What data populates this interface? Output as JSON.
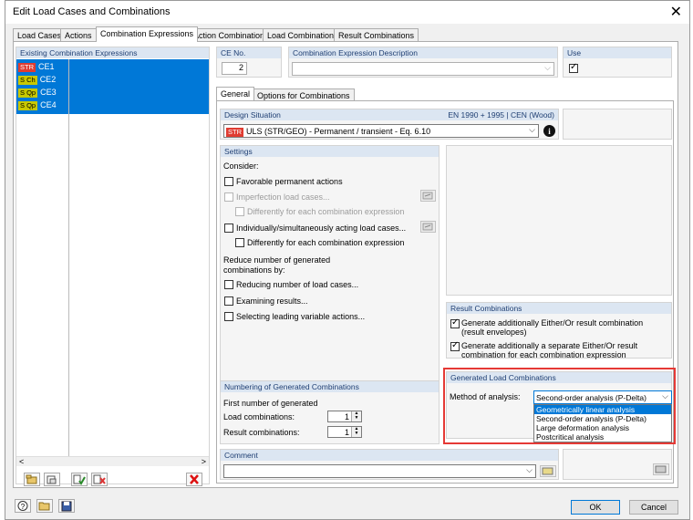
{
  "window": {
    "title": "Edit Load Cases and Combinations"
  },
  "tabs": [
    "Load Cases",
    "Actions",
    "Combination Expressions",
    "Action Combinations",
    "Load Combinations",
    "Result Combinations"
  ],
  "left": {
    "header": "Existing Combination Expressions",
    "items": [
      {
        "tag": "STR",
        "tag_color": "#e03c31",
        "label": "CE1"
      },
      {
        "tag": "S Ch",
        "tag_color": "#c8c800",
        "label": "CE2"
      },
      {
        "tag": "S Qp",
        "tag_color": "#c8c800",
        "label": "CE3"
      },
      {
        "tag": "S Qp",
        "tag_color": "#c8c800",
        "label": "CE4"
      }
    ],
    "scroll_left": "<",
    "scroll_right": ">"
  },
  "ce_no": {
    "label": "CE No.",
    "value": "2"
  },
  "description": {
    "label": "Combination Expression Description",
    "value": ""
  },
  "use": {
    "label": "Use",
    "checked": true
  },
  "subtabs": [
    "General",
    "Options for Combinations"
  ],
  "design_situation": {
    "label": "Design Situation",
    "standard": "EN 1990 + 1995 | CEN (Wood)",
    "tag": "STR",
    "value": "ULS (STR/GEO) - Permanent / transient - Eq. 6.10"
  },
  "settings": {
    "header": "Settings",
    "consider": "Consider:",
    "favorable": "Favorable permanent actions",
    "imperfection": "Imperfection load cases...",
    "imperfection_diff": "Differently for each combination expression",
    "individually": "Individually/simultaneously acting load cases...",
    "individually_diff": "Differently for each combination expression",
    "reduce_title": "Reduce number of generated combinations by:",
    "reducing": "Reducing number of load cases...",
    "examining": "Examining results...",
    "selecting": "Selecting leading variable actions..."
  },
  "numbering": {
    "header": "Numbering of Generated Combinations",
    "first": "First number of generated",
    "load_label": "Load combinations:",
    "load_value": "1",
    "result_label": "Result combinations:",
    "result_value": "1"
  },
  "result_combinations": {
    "header": "Result Combinations",
    "opt1": "Generate additionally Either/Or result combination (result envelopes)",
    "opt2": "Generate additionally a separate Either/Or result combination for each combination expression"
  },
  "generated": {
    "header": "Generated Load Combinations",
    "method_label": "Method of analysis:",
    "method_value": "Second-order analysis (P-Delta)",
    "options": [
      "Geometrically linear analysis",
      "Second-order analysis (P-Delta)",
      "Large deformation analysis",
      "Postcritical analysis"
    ]
  },
  "comment": {
    "label": "Comment",
    "value": ""
  },
  "buttons": {
    "ok": "OK",
    "cancel": "Cancel"
  }
}
